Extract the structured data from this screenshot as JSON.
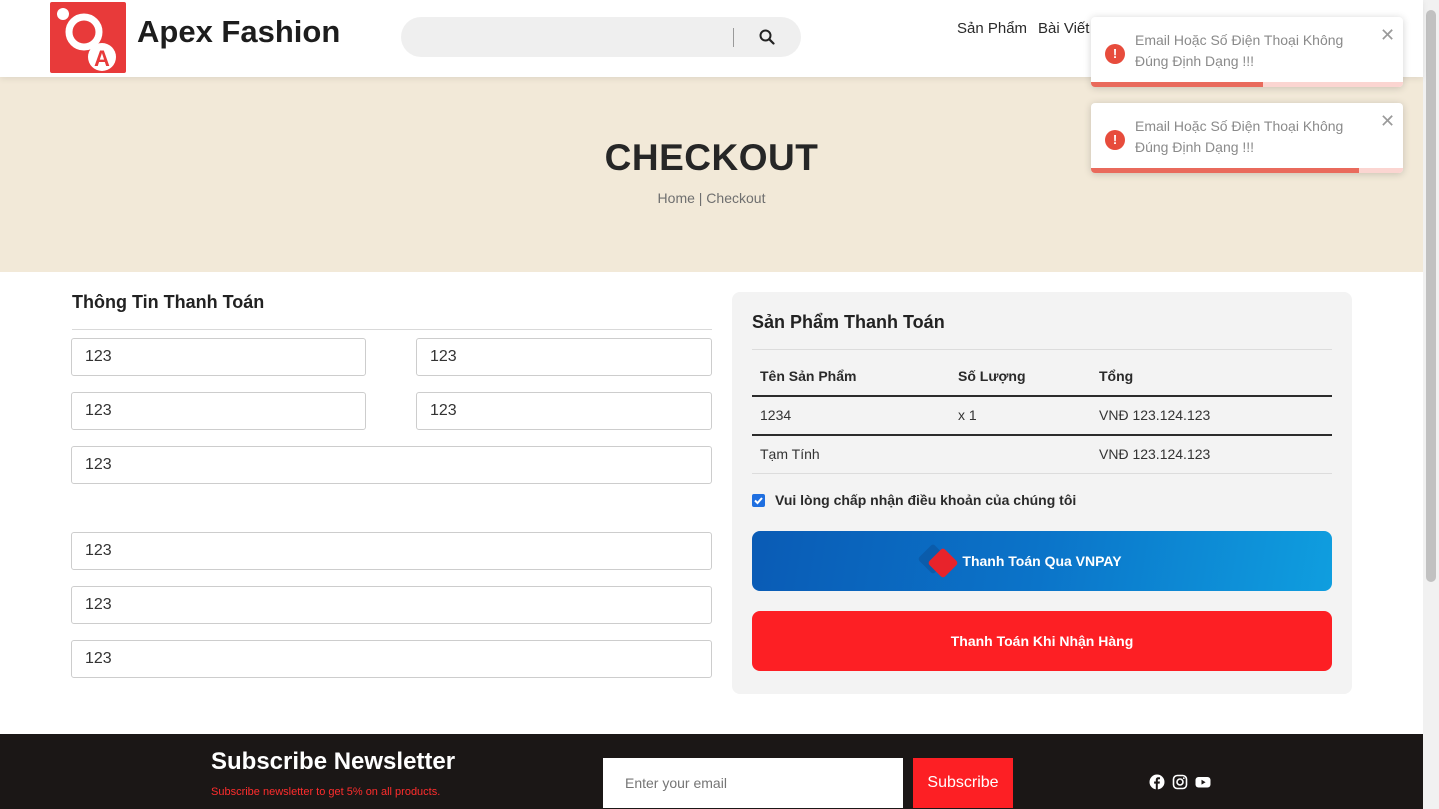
{
  "header": {
    "brand": "Apex Fashion",
    "search": {
      "value": ""
    },
    "nav": [
      "Sản Phẩm",
      "Bài Viết"
    ]
  },
  "banner": {
    "title": "CHECKOUT",
    "breadcrumb": "Home | Checkout"
  },
  "billing": {
    "title": "Thông Tin Thanh Toán",
    "fields": [
      "123",
      "123",
      "123",
      "123",
      "123",
      "123",
      "123",
      "123"
    ]
  },
  "order": {
    "title": "Sản Phẩm Thanh Toán",
    "headers": {
      "name": "Tên Sản Phẩm",
      "qty": "Số Lượng",
      "total": "Tổng"
    },
    "row": {
      "name": "1234",
      "qty": "x 1",
      "total": "VNĐ 123.124.123"
    },
    "subtotal": {
      "label": "Tạm Tính",
      "value": "VNĐ 123.124.123"
    },
    "terms": "Vui lòng chấp nhận điều khoản của chúng tôi",
    "terms_checked": true,
    "vnpay_label": "Thanh Toán Qua VNPAY",
    "cod_label": "Thanh Toán Khi Nhận Hàng"
  },
  "footer": {
    "newsletter_title": "Subscribe Newsletter",
    "newsletter_sub": "Subscribe newsletter to get 5% on all products.",
    "email_placeholder": "Enter your email",
    "subscribe_label": "Subscribe",
    "social_icons": [
      "facebook-icon",
      "instagram-icon",
      "youtube-icon"
    ]
  },
  "toasts": [
    {
      "message": "Email Hoặc Số Điện Thoại Không Đúng Định Dạng !!!",
      "progress": 0.55
    },
    {
      "message": "Email Hoặc Số Điện Thoại Không Đúng Định Dạng !!!",
      "progress": 0.86
    }
  ],
  "colors": {
    "accent_red": "#fd1f24",
    "banner_bg": "#f2e9d8",
    "footer_bg": "#1b1716",
    "error": "#e74c3c"
  }
}
